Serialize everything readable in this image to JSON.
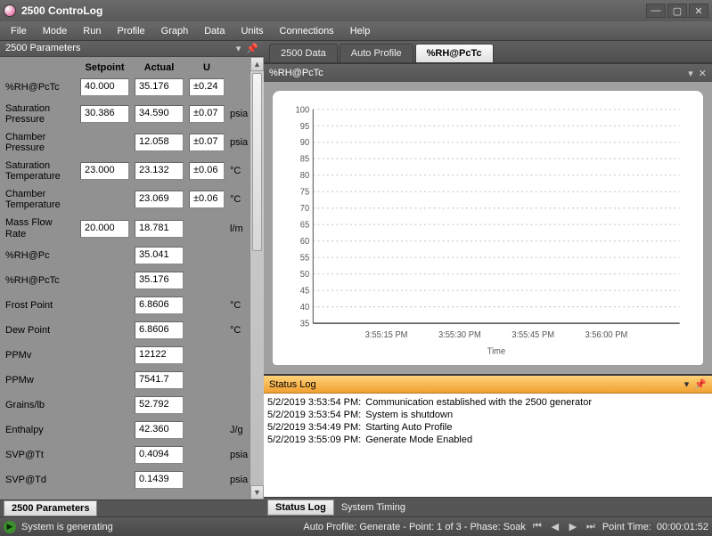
{
  "window": {
    "title": "2500 ControLog"
  },
  "menu": [
    "File",
    "Mode",
    "Run",
    "Profile",
    "Graph",
    "Data",
    "Units",
    "Connections",
    "Help"
  ],
  "left": {
    "title": "2500 Parameters",
    "headers": {
      "setpoint": "Setpoint",
      "actual": "Actual",
      "u": "U"
    },
    "rows": [
      {
        "label": "%RH@PcTc",
        "setpoint": "40.000",
        "actual": "35.176",
        "u": "±0.24",
        "unit": ""
      },
      {
        "label": "Saturation Pressure",
        "setpoint": "30.386",
        "actual": "34.590",
        "u": "±0.07",
        "unit": "psia"
      },
      {
        "label": "Chamber Pressure",
        "setpoint": "",
        "actual": "12.058",
        "u": "±0.07",
        "unit": "psia"
      },
      {
        "label": "Saturation Temperature",
        "setpoint": "23.000",
        "actual": "23.132",
        "u": "±0.06",
        "unit": "°C"
      },
      {
        "label": "Chamber Temperature",
        "setpoint": "",
        "actual": "23.069",
        "u": "±0.06",
        "unit": "°C"
      },
      {
        "label": "Mass Flow Rate",
        "setpoint": "20.000",
        "actual": "18.781",
        "u": "",
        "unit": "l/m"
      },
      {
        "label": "%RH@Pc",
        "setpoint": "",
        "actual": "35.041",
        "u": "",
        "unit": ""
      },
      {
        "label": "%RH@PcTc",
        "setpoint": "",
        "actual": "35.176",
        "u": "",
        "unit": ""
      },
      {
        "label": "Frost Point",
        "setpoint": "",
        "actual": "6.8606",
        "u": "",
        "unit": "°C"
      },
      {
        "label": "Dew Point",
        "setpoint": "",
        "actual": "6.8606",
        "u": "",
        "unit": "°C"
      },
      {
        "label": "PPMv",
        "setpoint": "",
        "actual": "12122",
        "u": "",
        "unit": ""
      },
      {
        "label": "PPMw",
        "setpoint": "",
        "actual": "7541.7",
        "u": "",
        "unit": ""
      },
      {
        "label": "Grains/lb",
        "setpoint": "",
        "actual": "52.792",
        "u": "",
        "unit": ""
      },
      {
        "label": "Enthalpy",
        "setpoint": "",
        "actual": "42.360",
        "u": "",
        "unit": "J/g"
      },
      {
        "label": "SVP@Tt",
        "setpoint": "",
        "actual": "0.4094",
        "u": "",
        "unit": "psia"
      },
      {
        "label": "SVP@Td",
        "setpoint": "",
        "actual": "0.1439",
        "u": "",
        "unit": "psia"
      }
    ],
    "bottom_tab": "2500 Parameters"
  },
  "tabs": [
    "2500 Data",
    "Auto Profile",
    "%RH@PcTc"
  ],
  "active_tab": 2,
  "chart": {
    "title": "%RH@PcTc"
  },
  "chart_data": {
    "type": "line",
    "title": "%RH@PcTc",
    "xlabel": "Time",
    "ylabel": "",
    "ylim": [
      35,
      100
    ],
    "yticks": [
      35,
      40,
      45,
      50,
      55,
      60,
      65,
      70,
      75,
      80,
      85,
      90,
      95,
      100
    ],
    "xticks": [
      "3:55:15 PM",
      "3:55:30 PM",
      "3:55:45 PM",
      "3:56:00 PM"
    ],
    "series": [
      {
        "name": "%RH@PcTc",
        "values": [
          35,
          35,
          35,
          35
        ]
      }
    ]
  },
  "status": {
    "title": "Status Log",
    "entries": [
      {
        "time": "5/2/2019 3:53:54 PM:",
        "msg": "Communication established with the 2500 generator"
      },
      {
        "time": "5/2/2019 3:53:54 PM:",
        "msg": "System is shutdown"
      },
      {
        "time": "5/2/2019 3:54:49 PM:",
        "msg": "Starting Auto Profile"
      },
      {
        "time": "5/2/2019 3:55:09 PM:",
        "msg": "Generate Mode Enabled"
      }
    ],
    "tabs": [
      "Status Log",
      "System Timing"
    ]
  },
  "statusbar": {
    "sys": "System is generating",
    "profile": "Auto Profile: Generate - Point: 1 of 3 - Phase: Soak",
    "pt_label": "Point Time:",
    "pt_value": "00:00:01:52"
  }
}
